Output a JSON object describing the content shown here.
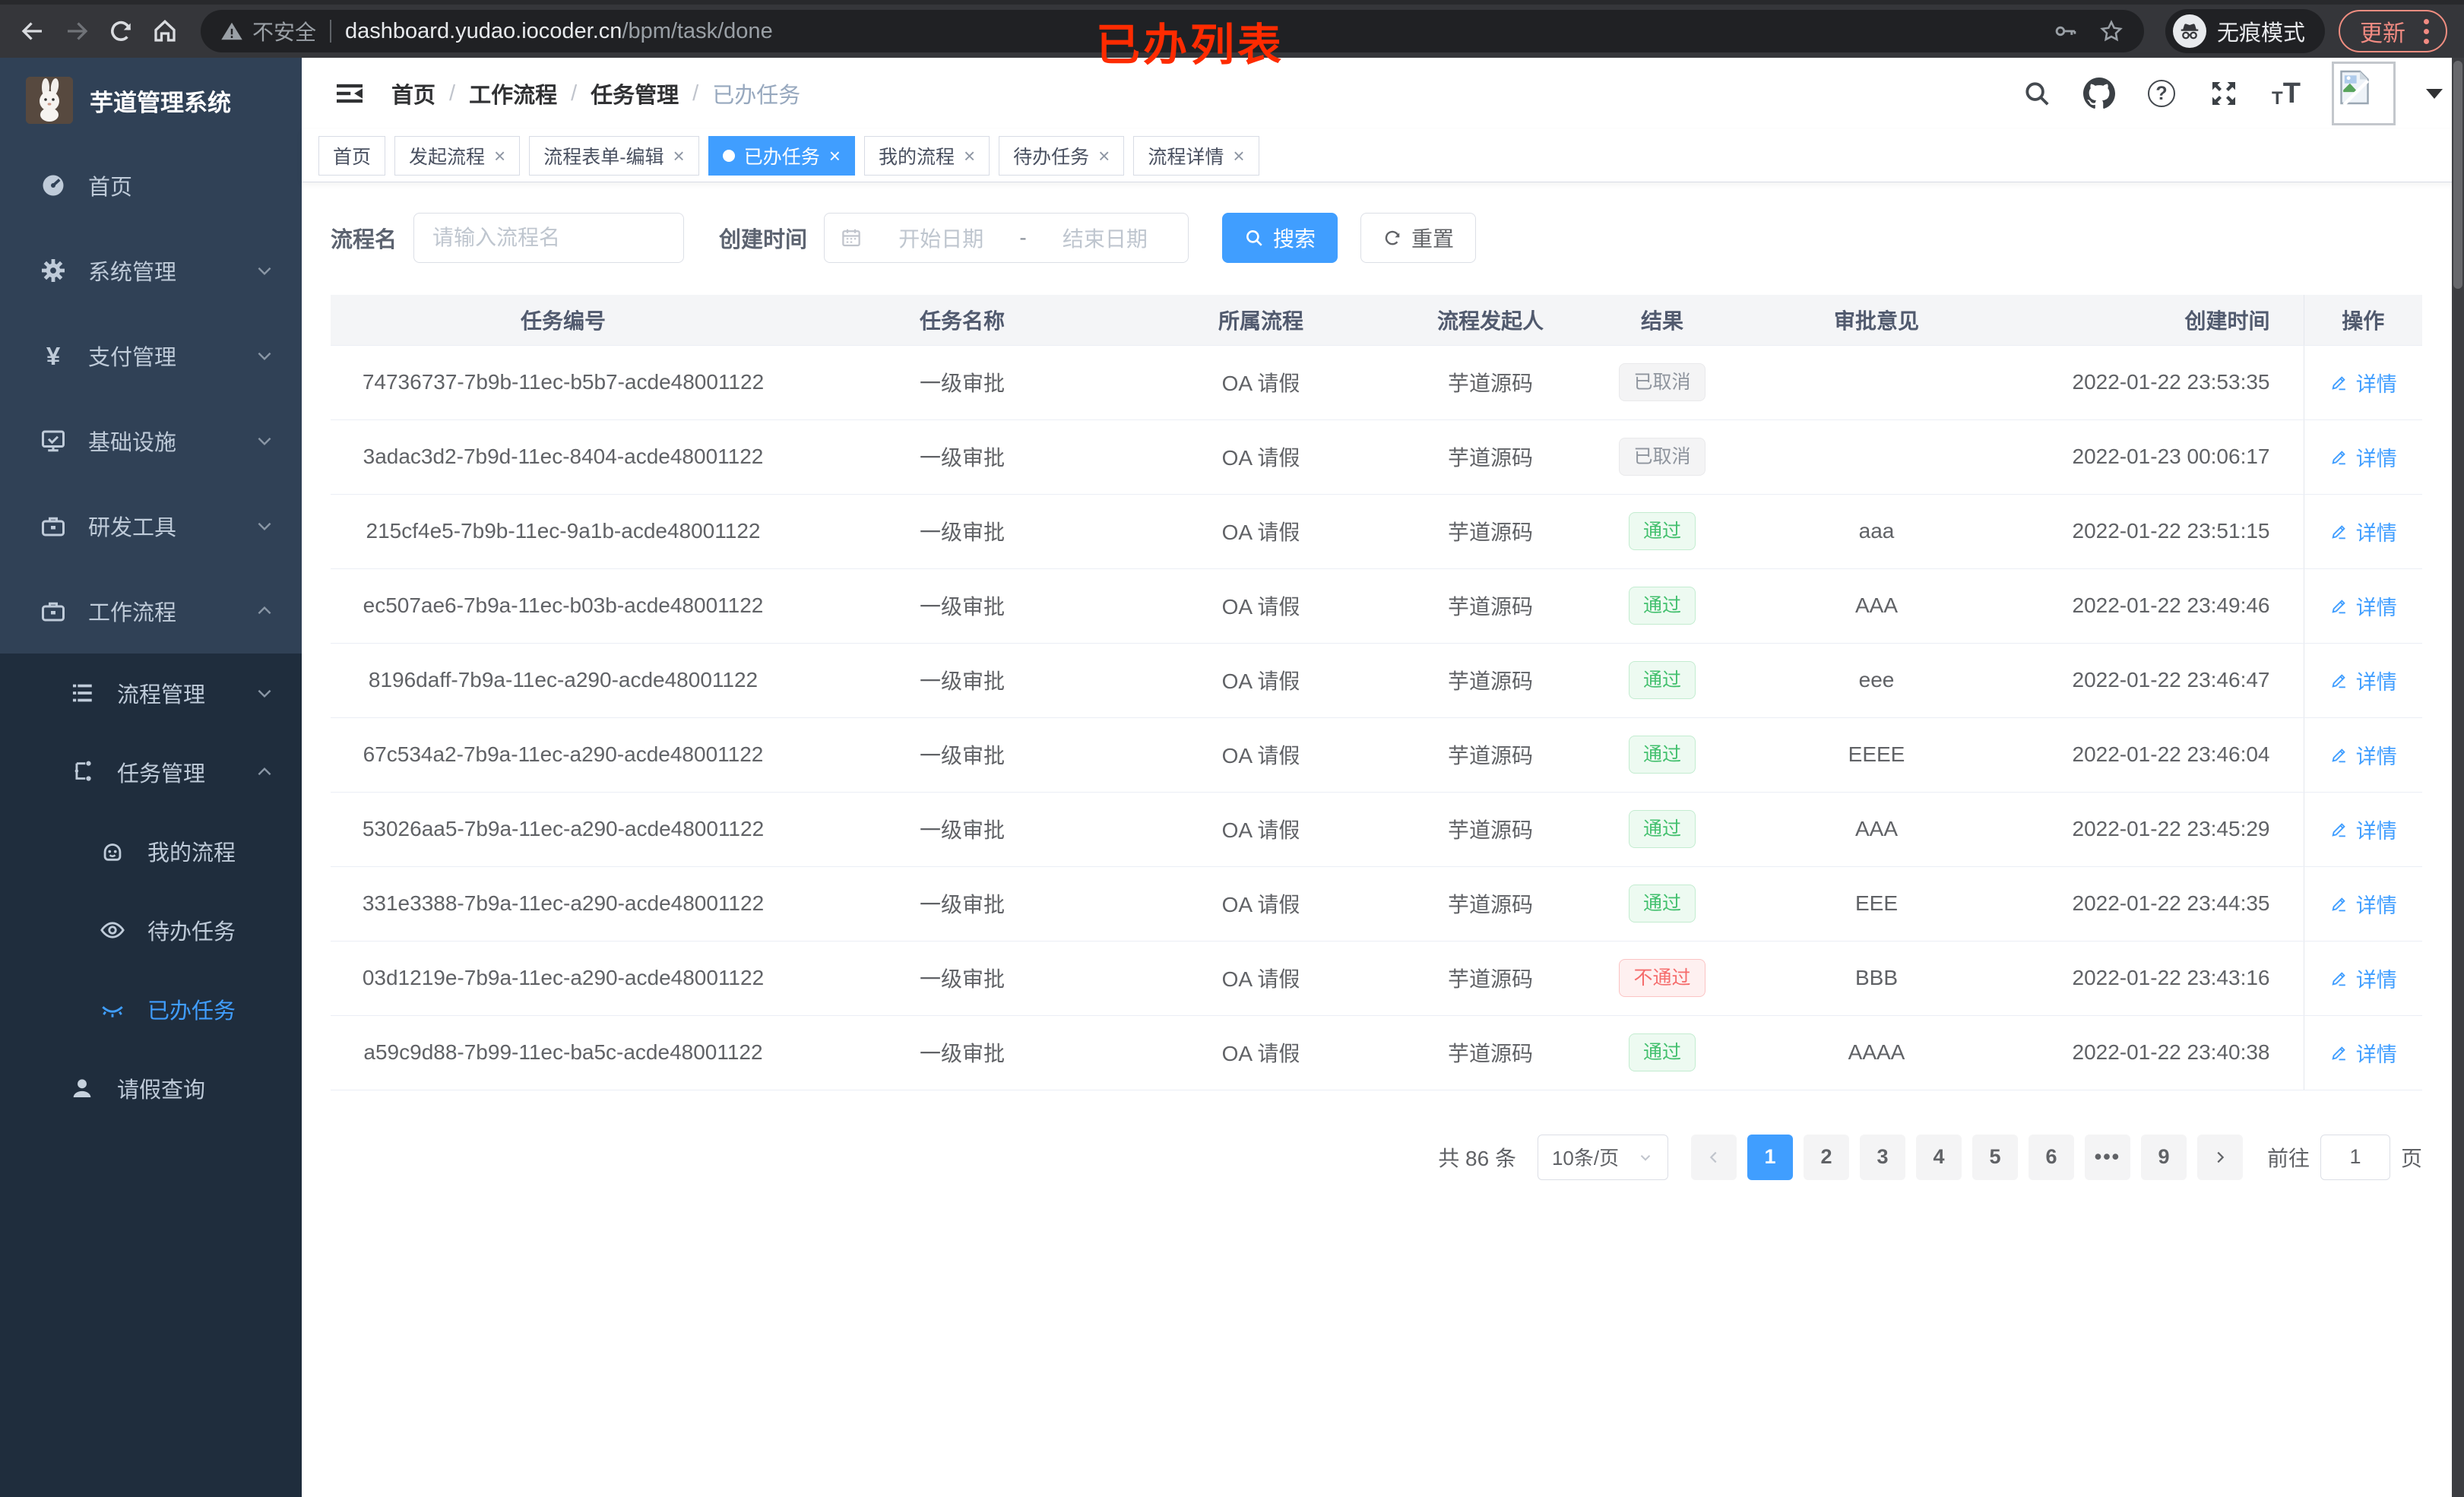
{
  "annotation": {
    "text": "已办列表",
    "color": "#fe2b00"
  },
  "browser": {
    "security_label": "不安全",
    "url_host": "dashboard.yudao.iocoder.cn",
    "url_path": "/bpm/task/done",
    "incognito_label": "无痕模式",
    "update_label": "更新"
  },
  "sidebar": {
    "app_title": "芋道管理系统",
    "items": [
      {
        "label": "首页",
        "icon": "dashboard-icon"
      },
      {
        "label": "系统管理",
        "icon": "gear-icon"
      },
      {
        "label": "支付管理",
        "icon": "yen-icon"
      },
      {
        "label": "基础设施",
        "icon": "monitor-icon"
      },
      {
        "label": "研发工具",
        "icon": "toolbox-icon"
      },
      {
        "label": "工作流程",
        "icon": "toolbox-icon"
      },
      {
        "label": "流程管理",
        "icon": "list-icon"
      },
      {
        "label": "任务管理",
        "icon": "flow-icon"
      },
      {
        "label": "我的流程",
        "icon": "robot-icon"
      },
      {
        "label": "待办任务",
        "icon": "eye-icon"
      },
      {
        "label": "已办任务",
        "icon": "eye-closed-icon"
      },
      {
        "label": "请假查询",
        "icon": "user-icon"
      }
    ]
  },
  "header": {
    "breadcrumbs": [
      "首页",
      "工作流程",
      "任务管理",
      "已办任务"
    ]
  },
  "tabs": [
    {
      "label": "首页"
    },
    {
      "label": "发起流程"
    },
    {
      "label": "流程表单-编辑"
    },
    {
      "label": "已办任务"
    },
    {
      "label": "我的流程"
    },
    {
      "label": "待办任务"
    },
    {
      "label": "流程详情"
    }
  ],
  "filters": {
    "name_label": "流程名",
    "name_placeholder": "请输入流程名",
    "time_label": "创建时间",
    "start_placeholder": "开始日期",
    "range_separator": "-",
    "end_placeholder": "结束日期",
    "search_label": "搜索",
    "reset_label": "重置"
  },
  "table": {
    "columns": [
      "任务编号",
      "任务名称",
      "所属流程",
      "流程发起人",
      "结果",
      "审批意见",
      "创建时间",
      "操作"
    ],
    "detail_label": "详情",
    "rows": [
      {
        "id": "74736737-7b9b-11ec-b5b7-acde48001122",
        "name": "一级审批",
        "process": "OA 请假",
        "starter": "芋道源码",
        "result": "已取消",
        "rtype": "info",
        "comment": "",
        "time": "2022-01-22 23:53:35"
      },
      {
        "id": "3adac3d2-7b9d-11ec-8404-acde48001122",
        "name": "一级审批",
        "process": "OA 请假",
        "starter": "芋道源码",
        "result": "已取消",
        "rtype": "info",
        "comment": "",
        "time": "2022-01-23 00:06:17"
      },
      {
        "id": "215cf4e5-7b9b-11ec-9a1b-acde48001122",
        "name": "一级审批",
        "process": "OA 请假",
        "starter": "芋道源码",
        "result": "通过",
        "rtype": "success",
        "comment": "aaa",
        "time": "2022-01-22 23:51:15"
      },
      {
        "id": "ec507ae6-7b9a-11ec-b03b-acde48001122",
        "name": "一级审批",
        "process": "OA 请假",
        "starter": "芋道源码",
        "result": "通过",
        "rtype": "success",
        "comment": "AAA",
        "time": "2022-01-22 23:49:46"
      },
      {
        "id": "8196daff-7b9a-11ec-a290-acde48001122",
        "name": "一级审批",
        "process": "OA 请假",
        "starter": "芋道源码",
        "result": "通过",
        "rtype": "success",
        "comment": "eee",
        "time": "2022-01-22 23:46:47"
      },
      {
        "id": "67c534a2-7b9a-11ec-a290-acde48001122",
        "name": "一级审批",
        "process": "OA 请假",
        "starter": "芋道源码",
        "result": "通过",
        "rtype": "success",
        "comment": "EEEE",
        "time": "2022-01-22 23:46:04"
      },
      {
        "id": "53026aa5-7b9a-11ec-a290-acde48001122",
        "name": "一级审批",
        "process": "OA 请假",
        "starter": "芋道源码",
        "result": "通过",
        "rtype": "success",
        "comment": "AAA",
        "time": "2022-01-22 23:45:29"
      },
      {
        "id": "331e3388-7b9a-11ec-a290-acde48001122",
        "name": "一级审批",
        "process": "OA 请假",
        "starter": "芋道源码",
        "result": "通过",
        "rtype": "success",
        "comment": "EEE",
        "time": "2022-01-22 23:44:35"
      },
      {
        "id": "03d1219e-7b9a-11ec-a290-acde48001122",
        "name": "一级审批",
        "process": "OA 请假",
        "starter": "芋道源码",
        "result": "不通过",
        "rtype": "danger",
        "comment": "BBB",
        "time": "2022-01-22 23:43:16"
      },
      {
        "id": "a59c9d88-7b99-11ec-ba5c-acde48001122",
        "name": "一级审批",
        "process": "OA 请假",
        "starter": "芋道源码",
        "result": "通过",
        "rtype": "success",
        "comment": "AAAA",
        "time": "2022-01-22 23:40:38"
      }
    ]
  },
  "pagination": {
    "total_label": "共 86 条",
    "page_size_label": "10条/页",
    "pages": [
      "1",
      "2",
      "3",
      "4",
      "5",
      "6",
      "•••",
      "9"
    ],
    "active_page": "1",
    "goto_label": "前往",
    "goto_value": "1",
    "page_unit": "页"
  }
}
